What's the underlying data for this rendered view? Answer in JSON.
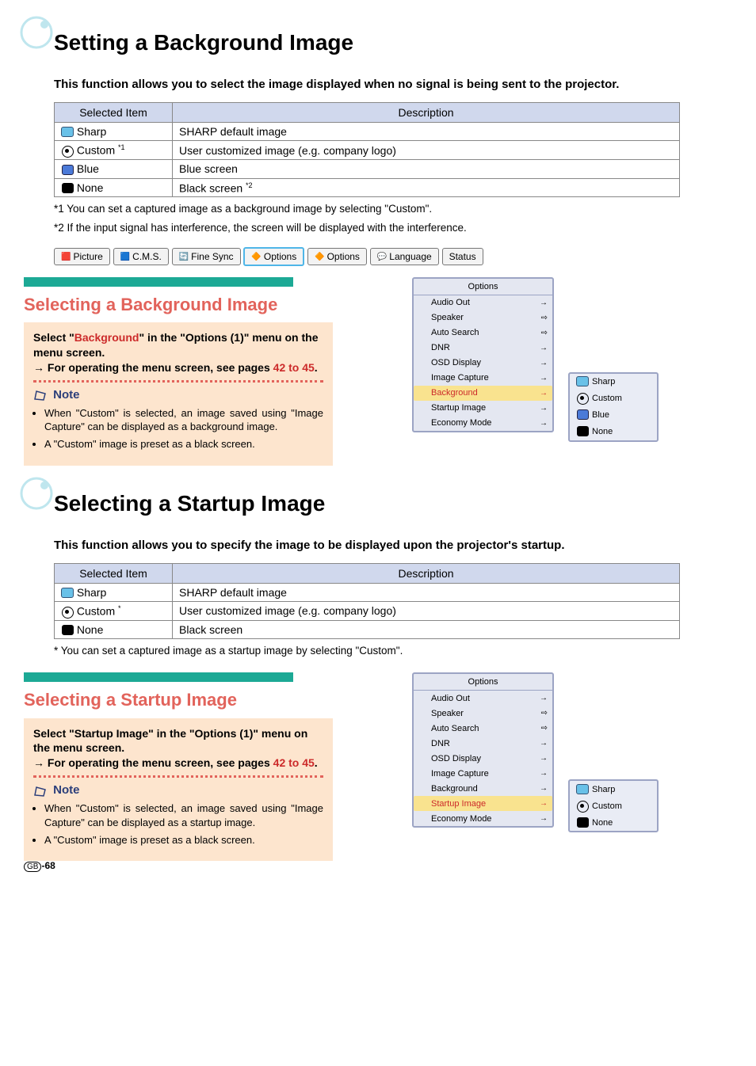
{
  "section1": {
    "title": "Setting a Background Image",
    "intro": "This function allows you to select the image displayed when no signal is being sent to the projector.",
    "table": {
      "head": [
        "Selected Item",
        "Description"
      ],
      "rows": [
        {
          "item": "Sharp",
          "desc": "SHARP default image",
          "icon": "sharp"
        },
        {
          "item": "Custom",
          "sup": "*1",
          "desc": "User customized image (e.g. company logo)",
          "icon": "custom"
        },
        {
          "item": "Blue",
          "desc": "Blue screen",
          "icon": "blue"
        },
        {
          "item": "None",
          "desc": "Black screen",
          "desc_sup": "*2",
          "icon": "none"
        }
      ]
    },
    "footnotes": [
      "*1 You can set a captured image as a background image by selecting \"Custom\".",
      "*2 If the input signal has interference, the screen will be displayed with the interference."
    ]
  },
  "tabs": [
    "Picture",
    "C.M.S.",
    "Fine Sync",
    "Options",
    "Options",
    "Language",
    "Status"
  ],
  "sub1": {
    "heading": "Selecting a Background Image",
    "para1a": "Select \"",
    "para1b_red": "Background",
    "para1c": "\" in the \"Options (1)\" menu on the menu screen.",
    "para2": "For operating the menu screen, see pages",
    "para2_red": "42 to 45",
    "note_label": "Note",
    "notes": [
      "When \"Custom\" is selected, an image saved using \"Image Capture\" can be displayed as a background image.",
      "A \"Custom\" image is preset as a black screen."
    ]
  },
  "panel1": {
    "header": "Options",
    "rows": [
      {
        "label": "Audio Out",
        "arrow": "→"
      },
      {
        "label": "Speaker",
        "arrow": "⇨"
      },
      {
        "label": "Auto Search",
        "arrow": "⇨"
      },
      {
        "label": "DNR",
        "arrow": "→"
      },
      {
        "label": "OSD Display",
        "arrow": "→"
      },
      {
        "label": "Image Capture",
        "arrow": "→"
      },
      {
        "label": "Background",
        "arrow": "→",
        "sel": true
      },
      {
        "label": "Startup Image",
        "arrow": "→"
      },
      {
        "label": "Economy Mode",
        "arrow": "→"
      }
    ],
    "submenu": [
      {
        "label": "Sharp",
        "icon": "sharp"
      },
      {
        "label": "Custom",
        "icon": "custom"
      },
      {
        "label": "Blue",
        "icon": "blue"
      },
      {
        "label": "None",
        "icon": "none"
      }
    ]
  },
  "section2": {
    "title": "Selecting a Startup Image",
    "intro": "This function allows you to specify the image to be displayed upon the projector's startup.",
    "table": {
      "head": [
        "Selected Item",
        "Description"
      ],
      "rows": [
        {
          "item": "Sharp",
          "desc": "SHARP default image",
          "icon": "sharp"
        },
        {
          "item": "Custom",
          "sup": "*",
          "desc": "User customized image (e.g. company logo)",
          "icon": "custom"
        },
        {
          "item": "None",
          "desc": "Black screen",
          "icon": "none"
        }
      ]
    },
    "footnotes": [
      "* You can set a captured image as a startup image by selecting \"Custom\"."
    ]
  },
  "sub2": {
    "heading": "Selecting a Startup Image",
    "para1": "Select \"Startup Image\" in the \"Options (1)\" menu on the menu screen.",
    "para2": "For operating the menu screen, see pages",
    "para2_red": "42 to 45",
    "note_label": "Note",
    "notes": [
      "When \"Custom\" is selected, an image saved using \"Image Capture\" can be displayed as a startup image.",
      "A \"Custom\" image is preset as a black screen."
    ]
  },
  "panel2": {
    "header": "Options",
    "rows": [
      {
        "label": "Audio Out",
        "arrow": "→"
      },
      {
        "label": "Speaker",
        "arrow": "⇨"
      },
      {
        "label": "Auto Search",
        "arrow": "⇨"
      },
      {
        "label": "DNR",
        "arrow": "→"
      },
      {
        "label": "OSD Display",
        "arrow": "→"
      },
      {
        "label": "Image Capture",
        "arrow": "→"
      },
      {
        "label": "Background",
        "arrow": "→"
      },
      {
        "label": "Startup Image",
        "arrow": "→",
        "sel": true
      },
      {
        "label": "Economy Mode",
        "arrow": "→"
      }
    ],
    "submenu": [
      {
        "label": "Sharp",
        "icon": "sharp"
      },
      {
        "label": "Custom",
        "icon": "custom"
      },
      {
        "label": "None",
        "icon": "none"
      }
    ]
  },
  "page": {
    "gb": "GB",
    "num": "-68"
  }
}
